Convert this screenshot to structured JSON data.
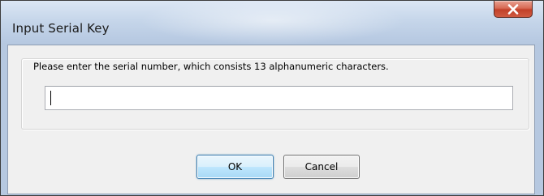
{
  "window": {
    "title": "Input Serial Key"
  },
  "title_bar": {
    "close_icon": "close-x-icon",
    "close_color": "#c7432b"
  },
  "form": {
    "prompt": "Please enter the serial number, which consists 13 alphanumeric characters.",
    "serial_value": "",
    "serial_placeholder": ""
  },
  "buttons": {
    "ok_label": "OK",
    "cancel_label": "Cancel"
  },
  "colors": {
    "title_bar": "#c6d6ea",
    "client_background": "#f0f0f0",
    "default_button_border": "#3c7fb1"
  }
}
